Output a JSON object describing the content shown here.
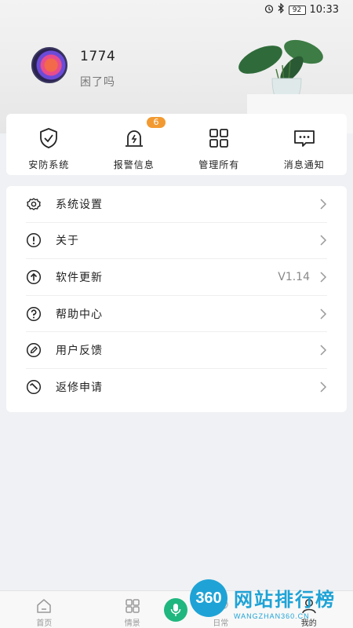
{
  "status_bar": {
    "battery": "92",
    "time": "10:33"
  },
  "profile": {
    "name": "1774",
    "status": "困了吗"
  },
  "quick_actions": [
    {
      "label": "安防系统",
      "icon": "shield-check-icon"
    },
    {
      "label": "报警信息",
      "icon": "alarm-bell-icon",
      "badge": "6"
    },
    {
      "label": "管理所有",
      "icon": "grid-icon"
    },
    {
      "label": "消息通知",
      "icon": "message-icon"
    }
  ],
  "menu": [
    {
      "label": "系统设置",
      "icon": "gear-icon",
      "value": ""
    },
    {
      "label": "关于",
      "icon": "info-exclamation-icon",
      "value": ""
    },
    {
      "label": "软件更新",
      "icon": "upload-arrow-icon",
      "value": "V1.14"
    },
    {
      "label": "帮助中心",
      "icon": "help-question-icon",
      "value": ""
    },
    {
      "label": "用户反馈",
      "icon": "edit-pen-icon",
      "value": ""
    },
    {
      "label": "返修申请",
      "icon": "repair-icon",
      "value": ""
    }
  ],
  "tabs": [
    {
      "label": "首页",
      "icon": "home-icon"
    },
    {
      "label": "情景",
      "icon": "scenes-grid-icon"
    },
    {
      "label": "日常",
      "icon": "daily-icon"
    },
    {
      "label": "我的",
      "icon": "user-icon",
      "active": true
    }
  ],
  "watermark": {
    "logo": "360",
    "title": "网站排行榜",
    "subtitle": "WANGZHAN360.CN"
  },
  "colors": {
    "badge": "#f29a31",
    "voice": "#1fb77f",
    "watermark": "#1fa3d6",
    "background": "#eff1f4"
  }
}
